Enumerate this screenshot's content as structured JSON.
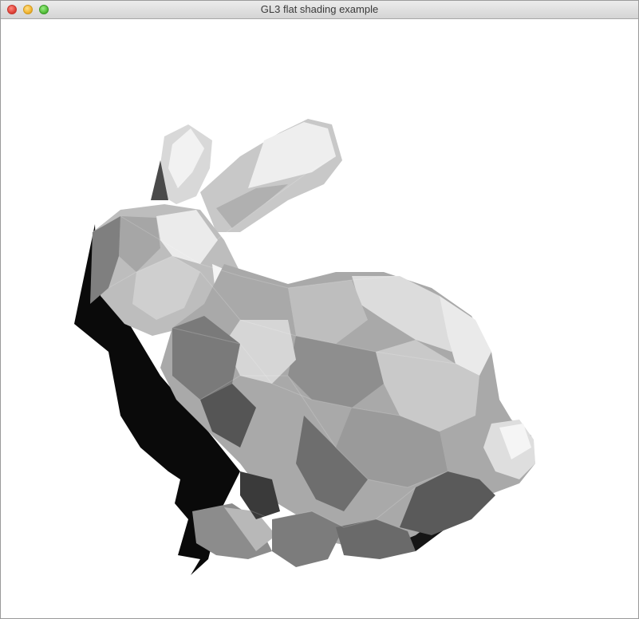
{
  "window": {
    "title": "GL3 flat shading example"
  },
  "titlebar_buttons": [
    {
      "name": "close",
      "color": "#e0443a"
    },
    {
      "name": "minimize",
      "color": "#f2b532"
    },
    {
      "name": "zoom",
      "color": "#56c03c"
    }
  ],
  "scene": {
    "background": "#ffffff",
    "subject": "bunny-mesh"
  }
}
